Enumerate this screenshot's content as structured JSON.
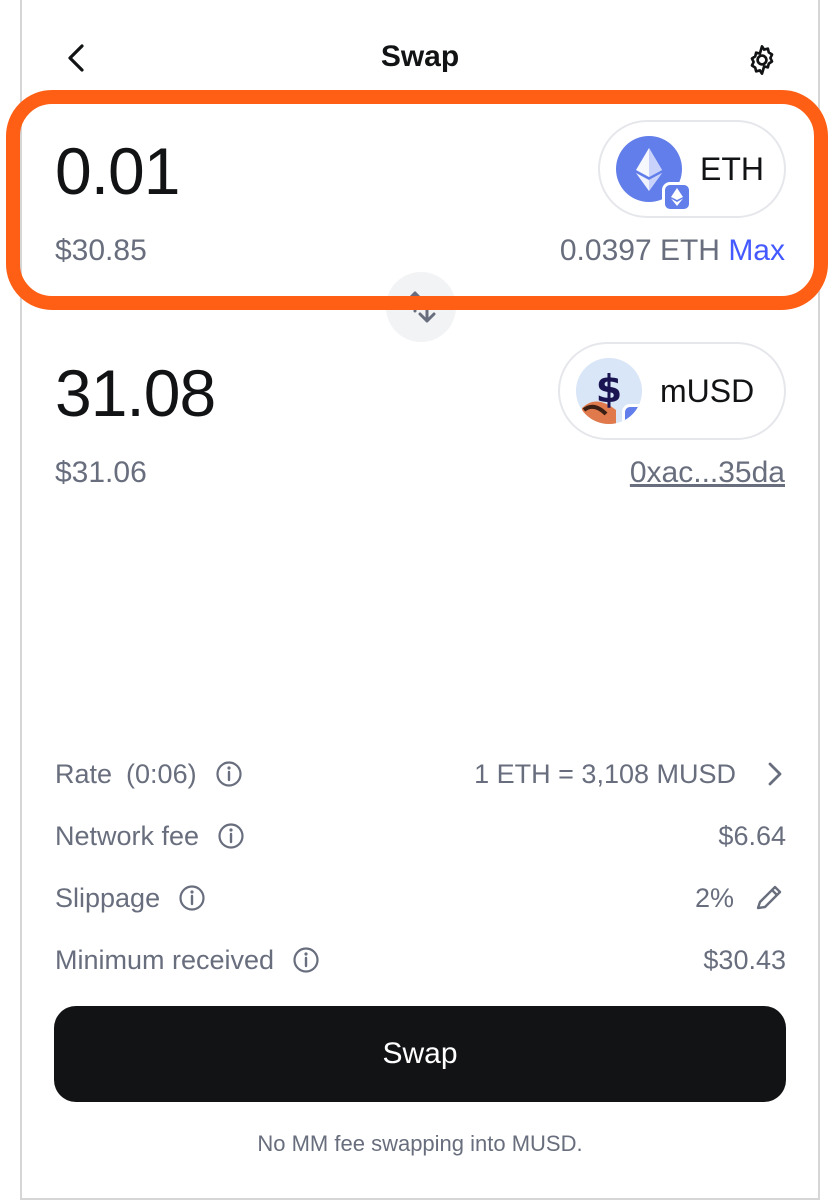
{
  "header": {
    "title": "Swap",
    "back_icon": "chevron-left-icon",
    "settings_icon": "gear-icon"
  },
  "source": {
    "amount": "0.01",
    "fiat": "$30.85",
    "token_symbol": "ETH",
    "balance": "0.0397 ETH",
    "max_label": "Max"
  },
  "destination": {
    "amount": "31.08",
    "fiat": "$31.06",
    "token_symbol": "mUSD",
    "address": "0xac...35da"
  },
  "details": {
    "rate_label": "Rate",
    "rate_timer": "(0:06)",
    "rate_value": "1 ETH = 3,108 MUSD",
    "network_fee_label": "Network fee",
    "network_fee_value": "$6.64",
    "slippage_label": "Slippage",
    "slippage_value": "2%",
    "min_received_label": "Minimum received",
    "min_received_value": "$30.43"
  },
  "swap_button_label": "Swap",
  "footnote": "No MM fee swapping into MUSD.",
  "colors": {
    "highlight": "#ff5f14",
    "accent": "#4459ff",
    "eth": "#627eea",
    "button": "#121314"
  }
}
